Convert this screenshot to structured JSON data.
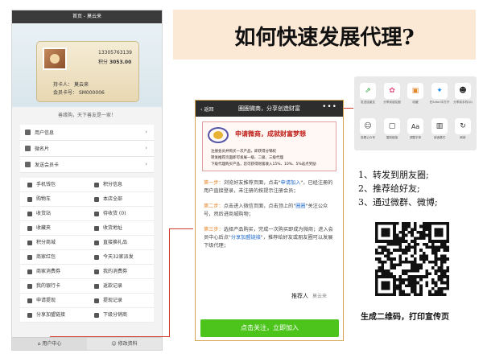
{
  "left_phone": {
    "title": "首页 - 莫云来",
    "card": {
      "phone": "13305763139",
      "points_label": "积分",
      "points": "3053.00",
      "holder_label": "持卡人：",
      "holder": "莫云来",
      "member_no_label": "会员卡号：",
      "member_no": "SM000006"
    },
    "tagline": "善缘购，天下善友是一家！",
    "list_rows": [
      {
        "label": "用户信息",
        "icon": "user-icon"
      },
      {
        "label": "微名片",
        "icon": "card-icon"
      },
      {
        "label": "发送会员卡",
        "icon": "send-icon"
      }
    ],
    "grid": [
      "手机钱包",
      "积分信息",
      "购物车",
      "本店全部",
      "收货站",
      "待收货 (0)",
      "收藏夹",
      "收货地址",
      "积分商城",
      "直接换礼品",
      "商家红包",
      "今天32家派发",
      "商家消费券",
      "我的消费券",
      "我的银行卡",
      "返款记录",
      "申请提现",
      "提现记录",
      "分享加盟链接",
      "下级分销商"
    ],
    "footer": {
      "user_center": "用户中心",
      "edit_profile": "修改资料"
    }
  },
  "banner": {
    "title": "如何快速发展代理?"
  },
  "middle_phone": {
    "back": "返回",
    "title": "圈圈微商，分享创造财富",
    "more": "•••",
    "promo": {
      "headline": "申请微商，成就财富梦想",
      "line1": "注册会员并购买一次产品，即获得分销权",
      "line2": "转发推荐页面即可发展一级、二级、三级代理",
      "line3": "下级代理购买产品，您可获得财富收入15%、10%、5%返点奖励"
    },
    "step1": {
      "label": "第一步：",
      "text_a": "浏览好友推荐页面，点击\"",
      "highlight": "申请加入",
      "text_b": "\"，已经注册的用户直接登录，未注册的按提示注册会员；"
    },
    "step2": {
      "label": "第二步：",
      "text_a": "点击进入微信页面，点击顶上的\"",
      "highlight": "圈圈",
      "text_b": "\"关注公众号，然后进商城购物；"
    },
    "step3": {
      "label": "第三步：",
      "text_a": "选择产品购买，完成一次购买即成为微商；进入会员中心后点\"",
      "highlight": "分享加盟链接",
      "text_b": "\"，推荐给好友或朋友圈可以发展下级代理；"
    },
    "referrer_label": "推荐人",
    "referrer_name": "莫云来",
    "follow_button": "点击关注，立即加入"
  },
  "share_panel": {
    "items": [
      {
        "label": "发送给朋友",
        "icon": "share-icon"
      },
      {
        "label": "分享到朋友圈",
        "icon": "moments-icon"
      },
      {
        "label": "收藏",
        "icon": "favorite-icon"
      },
      {
        "label": "在Safari中打开",
        "icon": "safari-icon"
      },
      {
        "label": "分享到手机QQ",
        "icon": "qq-icon"
      },
      {
        "label": "查看公众号",
        "icon": "account-icon"
      },
      {
        "label": "复制链接",
        "icon": "copy-link-icon"
      },
      {
        "label": "调整字体",
        "icon": "font-icon"
      },
      {
        "label": "阅读模式",
        "icon": "read-mode-icon"
      },
      {
        "label": "刷新",
        "icon": "refresh-icon"
      }
    ]
  },
  "tips": [
    "1、转发到朋友圈;",
    "2、推荐给好友;",
    "3、通过微群、微博;"
  ],
  "qr_caption": "生成二维码，打印宣传页"
}
